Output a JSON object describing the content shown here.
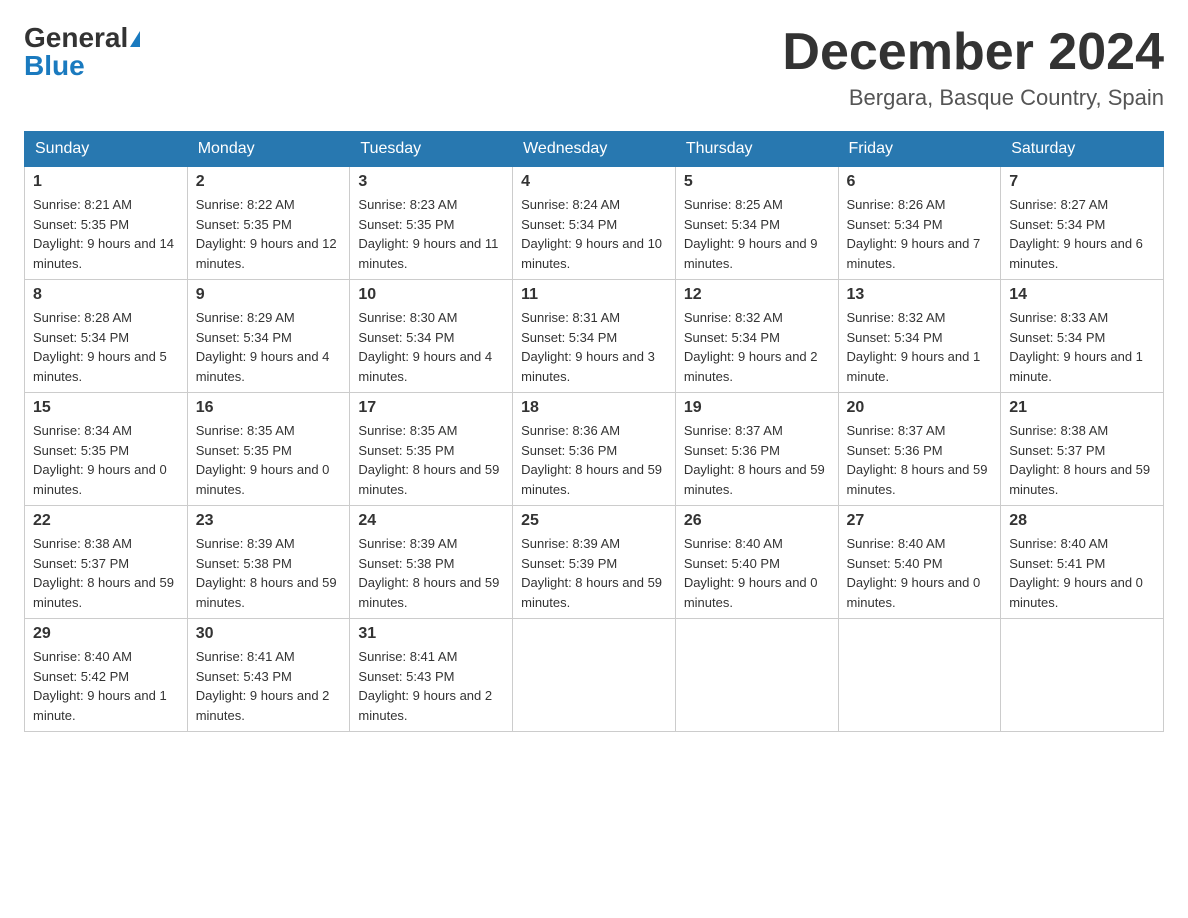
{
  "header": {
    "logo_general": "General",
    "logo_blue": "Blue",
    "month_title": "December 2024",
    "location": "Bergara, Basque Country, Spain"
  },
  "weekdays": [
    "Sunday",
    "Monday",
    "Tuesday",
    "Wednesday",
    "Thursday",
    "Friday",
    "Saturday"
  ],
  "weeks": [
    [
      {
        "day": "1",
        "sunrise": "8:21 AM",
        "sunset": "5:35 PM",
        "daylight": "9 hours and 14 minutes."
      },
      {
        "day": "2",
        "sunrise": "8:22 AM",
        "sunset": "5:35 PM",
        "daylight": "9 hours and 12 minutes."
      },
      {
        "day": "3",
        "sunrise": "8:23 AM",
        "sunset": "5:35 PM",
        "daylight": "9 hours and 11 minutes."
      },
      {
        "day": "4",
        "sunrise": "8:24 AM",
        "sunset": "5:34 PM",
        "daylight": "9 hours and 10 minutes."
      },
      {
        "day": "5",
        "sunrise": "8:25 AM",
        "sunset": "5:34 PM",
        "daylight": "9 hours and 9 minutes."
      },
      {
        "day": "6",
        "sunrise": "8:26 AM",
        "sunset": "5:34 PM",
        "daylight": "9 hours and 7 minutes."
      },
      {
        "day": "7",
        "sunrise": "8:27 AM",
        "sunset": "5:34 PM",
        "daylight": "9 hours and 6 minutes."
      }
    ],
    [
      {
        "day": "8",
        "sunrise": "8:28 AM",
        "sunset": "5:34 PM",
        "daylight": "9 hours and 5 minutes."
      },
      {
        "day": "9",
        "sunrise": "8:29 AM",
        "sunset": "5:34 PM",
        "daylight": "9 hours and 4 minutes."
      },
      {
        "day": "10",
        "sunrise": "8:30 AM",
        "sunset": "5:34 PM",
        "daylight": "9 hours and 4 minutes."
      },
      {
        "day": "11",
        "sunrise": "8:31 AM",
        "sunset": "5:34 PM",
        "daylight": "9 hours and 3 minutes."
      },
      {
        "day": "12",
        "sunrise": "8:32 AM",
        "sunset": "5:34 PM",
        "daylight": "9 hours and 2 minutes."
      },
      {
        "day": "13",
        "sunrise": "8:32 AM",
        "sunset": "5:34 PM",
        "daylight": "9 hours and 1 minute."
      },
      {
        "day": "14",
        "sunrise": "8:33 AM",
        "sunset": "5:34 PM",
        "daylight": "9 hours and 1 minute."
      }
    ],
    [
      {
        "day": "15",
        "sunrise": "8:34 AM",
        "sunset": "5:35 PM",
        "daylight": "9 hours and 0 minutes."
      },
      {
        "day": "16",
        "sunrise": "8:35 AM",
        "sunset": "5:35 PM",
        "daylight": "9 hours and 0 minutes."
      },
      {
        "day": "17",
        "sunrise": "8:35 AM",
        "sunset": "5:35 PM",
        "daylight": "8 hours and 59 minutes."
      },
      {
        "day": "18",
        "sunrise": "8:36 AM",
        "sunset": "5:36 PM",
        "daylight": "8 hours and 59 minutes."
      },
      {
        "day": "19",
        "sunrise": "8:37 AM",
        "sunset": "5:36 PM",
        "daylight": "8 hours and 59 minutes."
      },
      {
        "day": "20",
        "sunrise": "8:37 AM",
        "sunset": "5:36 PM",
        "daylight": "8 hours and 59 minutes."
      },
      {
        "day": "21",
        "sunrise": "8:38 AM",
        "sunset": "5:37 PM",
        "daylight": "8 hours and 59 minutes."
      }
    ],
    [
      {
        "day": "22",
        "sunrise": "8:38 AM",
        "sunset": "5:37 PM",
        "daylight": "8 hours and 59 minutes."
      },
      {
        "day": "23",
        "sunrise": "8:39 AM",
        "sunset": "5:38 PM",
        "daylight": "8 hours and 59 minutes."
      },
      {
        "day": "24",
        "sunrise": "8:39 AM",
        "sunset": "5:38 PM",
        "daylight": "8 hours and 59 minutes."
      },
      {
        "day": "25",
        "sunrise": "8:39 AM",
        "sunset": "5:39 PM",
        "daylight": "8 hours and 59 minutes."
      },
      {
        "day": "26",
        "sunrise": "8:40 AM",
        "sunset": "5:40 PM",
        "daylight": "9 hours and 0 minutes."
      },
      {
        "day": "27",
        "sunrise": "8:40 AM",
        "sunset": "5:40 PM",
        "daylight": "9 hours and 0 minutes."
      },
      {
        "day": "28",
        "sunrise": "8:40 AM",
        "sunset": "5:41 PM",
        "daylight": "9 hours and 0 minutes."
      }
    ],
    [
      {
        "day": "29",
        "sunrise": "8:40 AM",
        "sunset": "5:42 PM",
        "daylight": "9 hours and 1 minute."
      },
      {
        "day": "30",
        "sunrise": "8:41 AM",
        "sunset": "5:43 PM",
        "daylight": "9 hours and 2 minutes."
      },
      {
        "day": "31",
        "sunrise": "8:41 AM",
        "sunset": "5:43 PM",
        "daylight": "9 hours and 2 minutes."
      },
      null,
      null,
      null,
      null
    ]
  ],
  "labels": {
    "sunrise": "Sunrise:",
    "sunset": "Sunset:",
    "daylight": "Daylight:"
  }
}
